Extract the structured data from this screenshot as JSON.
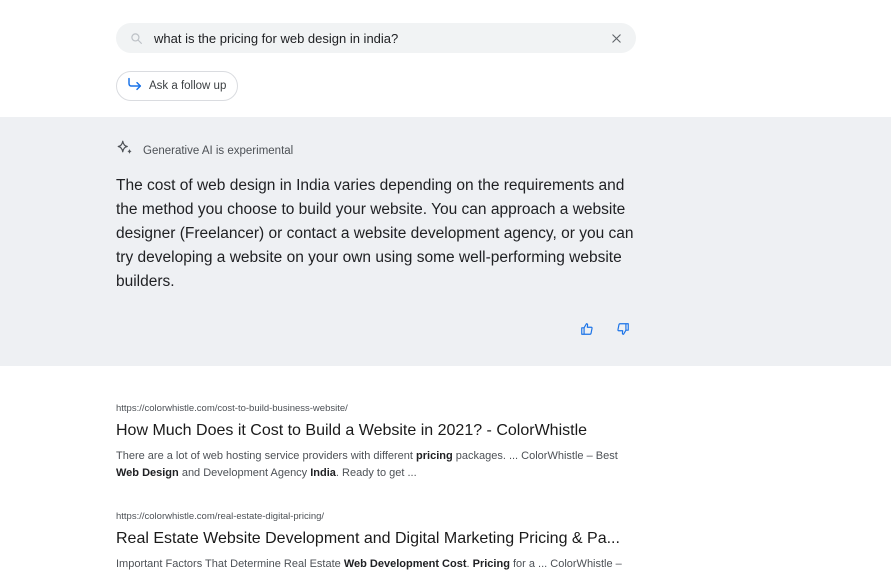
{
  "search": {
    "query": "what is the pricing for web design in india?",
    "search_icon": "search-icon",
    "clear_icon": "close-icon"
  },
  "followup": {
    "label": "Ask a follow up",
    "icon": "reply-arrow-icon"
  },
  "ai": {
    "badge_label": "Generative AI is experimental",
    "badge_icon": "sparkle-icon",
    "answer": "The cost of web design in India varies depending on the requirements and the method you choose to build your website. You can approach a website designer (Freelancer) or contact a website development agency, or you can try developing a website on your own using some well-performing website builders.",
    "feedback_icons": [
      "thumbs-up-icon",
      "thumbs-down-icon"
    ]
  },
  "results": [
    {
      "url": "https://colorwhistle.com/cost-to-build-business-website/",
      "title": "How Much Does it Cost to Build a Website in 2021? - ColorWhistle",
      "snippet_parts": [
        {
          "t": "There are a lot of web hosting service providers with different "
        },
        {
          "t": "pricing",
          "b": true
        },
        {
          "t": " packages. ... ColorWhistle – Best "
        },
        {
          "t": "Web Design",
          "b": true
        },
        {
          "t": " and Development Agency "
        },
        {
          "t": "India",
          "b": true
        },
        {
          "t": ". Ready to get ..."
        }
      ]
    },
    {
      "url": "https://colorwhistle.com/real-estate-digital-pricing/",
      "title": "Real Estate Website Development and Digital Marketing Pricing & Pa...",
      "snippet_parts": [
        {
          "t": "Important Factors That Determine Real Estate "
        },
        {
          "t": "Web Development Cost",
          "b": true
        },
        {
          "t": ". "
        },
        {
          "t": "Pricing",
          "b": true
        },
        {
          "t": " for a ... ColorWhistle –"
        }
      ]
    }
  ],
  "colors": {
    "panel_bg": "#eef0f3",
    "search_bg": "#f1f3f4",
    "feedback_blue": "#1a73e8"
  }
}
